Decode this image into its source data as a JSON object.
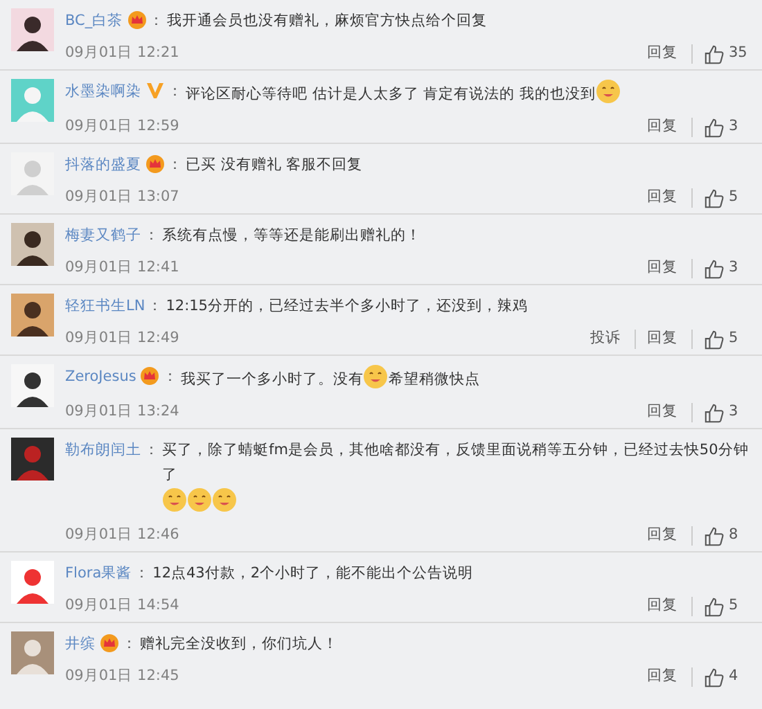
{
  "comments": [
    {
      "user": "BC_白茶",
      "crown": true,
      "colon": "：",
      "parts": [
        {
          "kind": "text",
          "text": "我开通会员也没有赠礼，麻烦官方快点给个回复"
        }
      ],
      "time": "09月01日 12:21",
      "reply": "回复",
      "likes": "35"
    },
    {
      "user": "水墨染啊染",
      "verified": true,
      "colon": "：",
      "parts": [
        {
          "kind": "text",
          "text": "评论区耐心等待吧 估计是人太多了 肯定有说法的 我的也没到"
        },
        {
          "kind": "emoji"
        }
      ],
      "time": "09月01日 12:59",
      "reply": "回复",
      "likes": "3"
    },
    {
      "user": "抖落的盛夏",
      "crown": true,
      "colon": "：",
      "parts": [
        {
          "kind": "text",
          "text": "已买 没有赠礼 客服不回复"
        }
      ],
      "time": "09月01日 13:07",
      "reply": "回复",
      "likes": "5"
    },
    {
      "user": "梅妻又鹤子",
      "colon": "：",
      "parts": [
        {
          "kind": "text",
          "text": "系统有点慢，等等还是能刷出赠礼的！"
        }
      ],
      "time": "09月01日 12:41",
      "reply": "回复",
      "likes": "3"
    },
    {
      "user": "轻狂书生LN",
      "colon": "：",
      "parts": [
        {
          "kind": "text",
          "text": "12:15分开的，已经过去半个多小时了，还没到，辣鸡"
        }
      ],
      "time": "09月01日 12:49",
      "report": "投诉",
      "reply": "回复",
      "likes": "5"
    },
    {
      "user": "ZeroJesus",
      "crown": true,
      "colon": "：",
      "parts": [
        {
          "kind": "text",
          "text": "我买了一个多小时了。没有"
        },
        {
          "kind": "emoji"
        },
        {
          "kind": "text",
          "text": "希望稍微快点"
        }
      ],
      "time": "09月01日 13:24",
      "reply": "回复",
      "likes": "3"
    },
    {
      "user": "勒布朗闰土",
      "colon": "：",
      "parts": [
        {
          "kind": "text",
          "text": "买了，除了蜻蜓fm是会员，其他啥都没有，反馈里面说稍等五分钟，已经过去快50分钟了"
        },
        {
          "kind": "emoji"
        },
        {
          "kind": "emoji"
        },
        {
          "kind": "emoji"
        }
      ],
      "time": "09月01日 12:46",
      "reply": "回复",
      "likes": "8"
    },
    {
      "user": "Flora果酱",
      "colon": "：",
      "parts": [
        {
          "kind": "text",
          "text": "12点43付款，2个小时了，能不能出个公告说明"
        }
      ],
      "time": "09月01日 14:54",
      "reply": "回复",
      "likes": "5"
    },
    {
      "user": "井缤",
      "crown": true,
      "colon": "：",
      "parts": [
        {
          "kind": "text",
          "text": "赠礼完全没收到，你们坑人！"
        }
      ],
      "time": "09月01日 12:45",
      "reply": "回复",
      "likes": "4"
    }
  ]
}
